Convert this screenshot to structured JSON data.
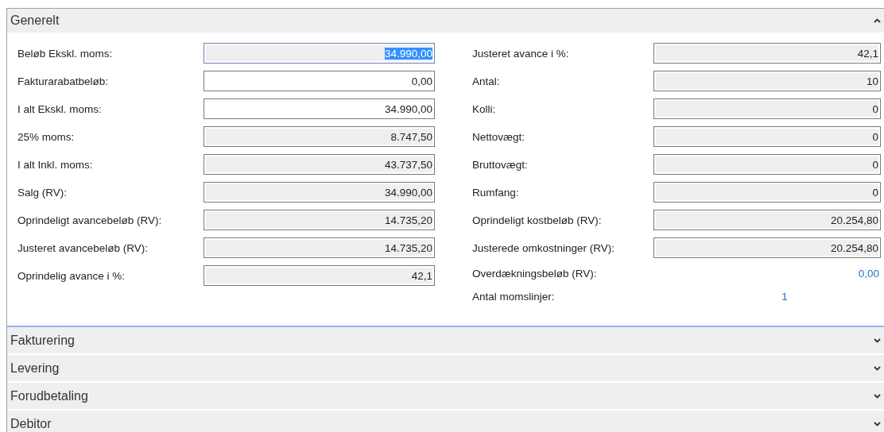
{
  "sections": [
    {
      "title": "Generelt",
      "expanded": true,
      "left_fields": [
        {
          "label": "Beløb Ekskl. moms:",
          "value": "34.990,00",
          "kind": "readonly",
          "focused": true
        },
        {
          "label": "Fakturarabatbeløb:",
          "value": "0,00",
          "kind": "editable",
          "focused": false
        },
        {
          "label": "I alt Ekskl. moms:",
          "value": "34.990,00",
          "kind": "editable",
          "focused": false
        },
        {
          "label": "25% moms:",
          "value": "8.747,50",
          "kind": "readonly",
          "focused": false
        },
        {
          "label": "I alt Inkl. moms:",
          "value": "43.737,50",
          "kind": "readonly",
          "focused": false
        },
        {
          "label": "Salg (RV):",
          "value": "34.990,00",
          "kind": "readonly",
          "focused": false
        },
        {
          "label": "Oprindeligt avancebeløb (RV):",
          "value": "14.735,20",
          "kind": "readonly",
          "focused": false
        },
        {
          "label": "Justeret avancebeløb (RV):",
          "value": "14.735,20",
          "kind": "readonly",
          "focused": false
        },
        {
          "label": "Oprindelig avance i %:",
          "value": "42,1",
          "kind": "readonly",
          "focused": false
        }
      ],
      "right_fields": [
        {
          "label": "Justeret avance i %:",
          "value": "42,1",
          "kind": "readonly",
          "focused": false
        },
        {
          "label": "Antal:",
          "value": "10",
          "kind": "readonly",
          "focused": false
        },
        {
          "label": "Kolli:",
          "value": "0",
          "kind": "readonly",
          "focused": false
        },
        {
          "label": "Nettovægt:",
          "value": "0",
          "kind": "readonly",
          "focused": false
        },
        {
          "label": "Bruttovægt:",
          "value": "0",
          "kind": "readonly",
          "focused": false
        },
        {
          "label": "Rumfang:",
          "value": "0",
          "kind": "readonly",
          "focused": false
        },
        {
          "label": "Oprindeligt kostbeløb (RV):",
          "value": "20.254,80",
          "kind": "readonly",
          "focused": false
        },
        {
          "label": "Justerede omkostninger (RV):",
          "value": "20.254,80",
          "kind": "readonly",
          "focused": false
        },
        {
          "label": "Overdækningsbeløb (RV):",
          "value": "0,00",
          "kind": "link"
        },
        {
          "label": "Antal momslinjer:",
          "value": "1",
          "kind": "count"
        }
      ]
    },
    {
      "title": "Fakturering",
      "expanded": false
    },
    {
      "title": "Levering",
      "expanded": false
    },
    {
      "title": "Forudbetaling",
      "expanded": false
    },
    {
      "title": "Debitor",
      "expanded": false
    }
  ]
}
